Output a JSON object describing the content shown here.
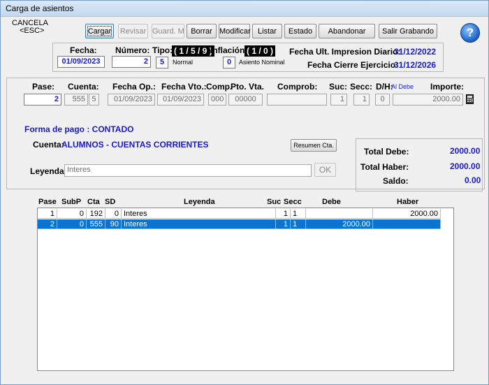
{
  "window": {
    "title": "Carga de asientos"
  },
  "toolbar": {
    "cancel_label": "CANCELA",
    "cancel_key": "<ESC>",
    "buttons": [
      "Cargar",
      "Revisar",
      "Guard. M",
      "Borrar",
      "Modificar",
      "Listar",
      "Estado",
      "Abandonar",
      "Salir Grabando"
    ],
    "help_icon": "?"
  },
  "header": {
    "fecha_label": "Fecha:",
    "fecha": "01/09/2023",
    "numero_label": "Número:",
    "numero": "2",
    "tipo_label": "Tipo:",
    "tipo_badge": "( 1 / 5 / 9 )",
    "tipo": "5",
    "tipo_desc": "Normal",
    "inflacion_label": "Inflación:",
    "inflacion_badge": "( 1 / 0 )",
    "inflacion": "0",
    "inflacion_desc": "Asiento Nominal",
    "ult_impresion_label": "Fecha Ult. Impresion Diario:",
    "ult_impresion": "31/12/2022",
    "cierre_label": "Fecha Cierre Ejercicio:",
    "cierre": "31/12/2026"
  },
  "entry": {
    "labels": {
      "pase": "Pase:",
      "cuenta": "Cuenta:",
      "fecha_op": "Fecha Op.:",
      "fecha_vto": "Fecha Vto.:",
      "comp": "Comp.",
      "pto_vta": "Pto. Vta.",
      "comprob": "Comprob:",
      "suc": "Suc:",
      "secc": "Secc:",
      "dh": "D/H:",
      "dh_hint": "Al Debe",
      "importe": "Importe:"
    },
    "values": {
      "pase": "2",
      "cuenta": "555",
      "sd": "5",
      "fecha_op": "01/09/2023",
      "fecha_vto": "01/09/2023",
      "comp": "000",
      "pto_vta": "00000",
      "comprob": "",
      "suc": "1",
      "secc": "1",
      "dh": "0",
      "importe": "2000.00"
    },
    "calc_icon": "calculator-icon"
  },
  "details": {
    "forma_pago": "Forma de pago : CONTADO",
    "cuenta_label": "Cuenta:",
    "cuenta_name": "ALUMNOS - CUENTAS CORRIENTES",
    "resumen_button": "Resumen Cta.",
    "leyenda_label": "Leyenda:",
    "leyenda_value": "Interes",
    "ok_button": "OK"
  },
  "totals": {
    "debe_label": "Total Debe:",
    "debe": "2000.00",
    "haber_label": "Total Haber:",
    "haber": "2000.00",
    "saldo_label": "Saldo:",
    "saldo": "0.00"
  },
  "grid": {
    "headers": [
      "Pase",
      "SubP",
      "Cta",
      "SD",
      "Leyenda",
      "Suc",
      "Secc",
      "Debe",
      "Haber"
    ],
    "rows": [
      {
        "pase": "1",
        "subp": "0",
        "cta": "192",
        "sd": "0",
        "leyenda": "Interes",
        "suc": "1",
        "secc": "1",
        "debe": "",
        "haber": "2000.00"
      },
      {
        "pase": "2",
        "subp": "0",
        "cta": "555",
        "sd": "90",
        "leyenda": "Interes",
        "suc": "1",
        "secc": "1",
        "debe": "2000.00",
        "haber": ""
      }
    ]
  }
}
